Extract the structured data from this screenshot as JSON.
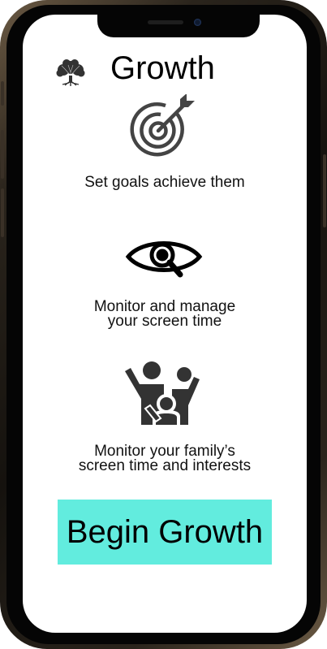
{
  "app": {
    "title": "Growth"
  },
  "features": [
    {
      "icon": "target-icon",
      "lines": [
        "Set goals achieve them"
      ]
    },
    {
      "icon": "eye-search-icon",
      "lines": [
        "Monitor and manage",
        "your screen time"
      ]
    },
    {
      "icon": "family-icon",
      "lines": [
        "Monitor your family’s",
        "screen time and interests"
      ]
    }
  ],
  "cta": {
    "label": "Begin Growth",
    "color": "#62ecde"
  }
}
